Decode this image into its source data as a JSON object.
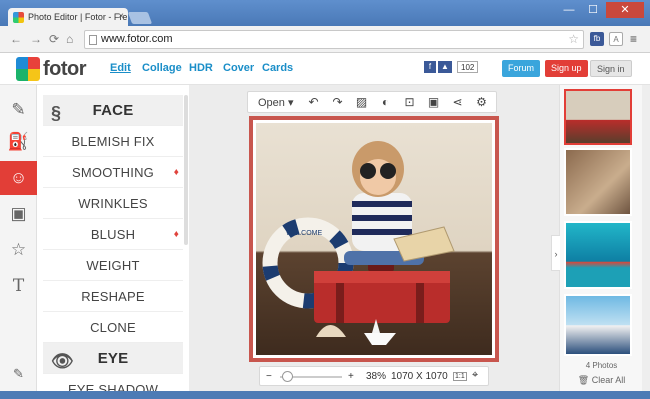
{
  "browser": {
    "tab_title": "Photo Editor | Fotor - Fre",
    "url": "www.fotor.com",
    "ext1": "fb",
    "ext2": "A"
  },
  "header": {
    "brand": "fotor",
    "menu": [
      "Edit",
      "Collage",
      "HDR",
      "Cover",
      "Cards"
    ],
    "share_count": "102",
    "forum": "Forum",
    "signup": "Sign up",
    "signin": "Sign in"
  },
  "rail": [
    "brush-icon",
    "paint-bucket-icon",
    "face-icon",
    "frame-icon",
    "sticker-star-icon",
    "text-icon",
    "edit-icon"
  ],
  "panel": {
    "items": [
      {
        "label": "FACE",
        "type": "category"
      },
      {
        "label": "BLEMISH FIX",
        "type": "tool"
      },
      {
        "label": "SMOOTHING",
        "type": "tool",
        "premium": true
      },
      {
        "label": "WRINKLES",
        "type": "tool"
      },
      {
        "label": "BLUSH",
        "type": "tool",
        "premium": true
      },
      {
        "label": "WEIGHT",
        "type": "tool"
      },
      {
        "label": "RESHAPE",
        "type": "tool"
      },
      {
        "label": "CLONE",
        "type": "tool"
      },
      {
        "label": "EYE",
        "type": "category"
      },
      {
        "label": "EYE SHADOW",
        "type": "tool"
      }
    ]
  },
  "canvas": {
    "open_label": "Open",
    "zoom": "38%",
    "dimensions": "1070 X 1070",
    "ring_text": "WELCOME",
    "fit_label": "1:1"
  },
  "right": {
    "photo_count": "4 Photos",
    "clear_all": "Clear All"
  },
  "colors": {
    "accent_red": "#e23e37",
    "link_blue": "#1a8ec8",
    "forum_blue": "#3aa5dc"
  }
}
